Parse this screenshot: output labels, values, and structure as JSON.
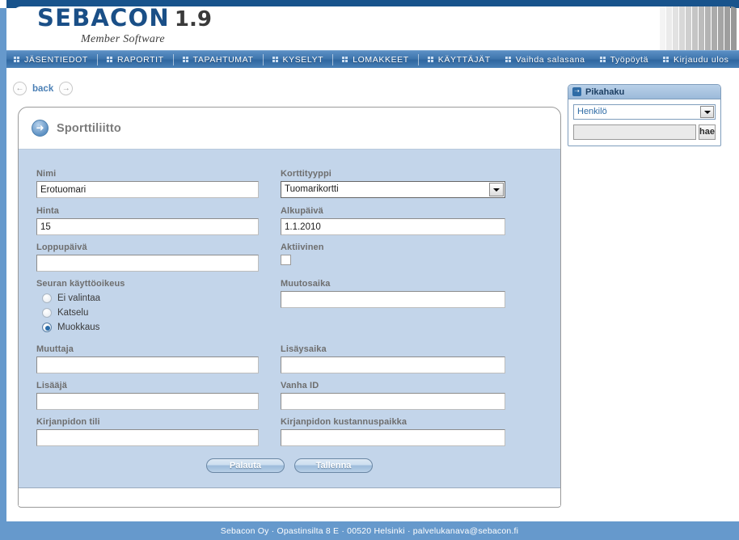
{
  "brand": {
    "name": "SEBACON",
    "version": "1.9",
    "tagline": "Member Software"
  },
  "nav": {
    "primary": [
      {
        "label": "JÄSENTIEDOT"
      },
      {
        "label": "RAPORTIT"
      },
      {
        "label": "TAPAHTUMAT"
      },
      {
        "label": "KYSELYT"
      },
      {
        "label": "LOMAKKEET"
      },
      {
        "label": "KÄYTTÄJÄT"
      }
    ],
    "secondary": [
      {
        "label": "Vaihda salasana"
      },
      {
        "label": "Työpöytä"
      },
      {
        "label": "Kirjaudu ulos"
      }
    ]
  },
  "backbar": {
    "label": "back",
    "prev_icon": "arrow-left-icon",
    "next_icon": "arrow-right-icon"
  },
  "card": {
    "icon": "arrow-right-circle-icon",
    "title": "Sporttiliitto"
  },
  "form": {
    "nimi": {
      "label": "Nimi",
      "value": "Erotuomari"
    },
    "korttityyppi": {
      "label": "Korttityyppi",
      "value": "Tuomarikortti"
    },
    "hinta": {
      "label": "Hinta",
      "value": "15"
    },
    "alkupaiva": {
      "label": "Alkupäivä",
      "value": "1.1.2010"
    },
    "loppupaiva": {
      "label": "Loppupäivä",
      "value": ""
    },
    "aktiivinen": {
      "label": "Aktiivinen",
      "checked": false
    },
    "seuran_kayttooikeus": {
      "label": "Seuran käyttöoikeus",
      "selected": "Muokkaus",
      "options": [
        {
          "label": "Ei valintaa",
          "selected": false
        },
        {
          "label": "Katselu",
          "selected": false
        },
        {
          "label": "Muokkaus",
          "selected": true
        }
      ]
    },
    "muutosaika": {
      "label": "Muutosaika",
      "value": ""
    },
    "muuttaja": {
      "label": "Muuttaja",
      "value": ""
    },
    "lisaysaika": {
      "label": "Lisäysaika",
      "value": ""
    },
    "lisaaja": {
      "label": "Lisääjä",
      "value": ""
    },
    "vanha_id": {
      "label": "Vanha ID",
      "value": ""
    },
    "kirjanpidon_tili": {
      "label": "Kirjanpidon tili",
      "value": ""
    },
    "kirjanpidon_kustannuspaikka": {
      "label": "Kirjanpidon kustannuspaikka",
      "value": ""
    }
  },
  "buttons": {
    "reset": "Palauta",
    "save": "Tallenna"
  },
  "quick_search": {
    "icon": "arrow-right-box-icon",
    "title": "Pikahaku",
    "type_value": "Henkilö",
    "input_value": "",
    "search_button": "hae"
  },
  "footer": {
    "text": "Sebacon Oy · Opastinsilta 8 E · 00520 Helsinki · palvelukanava@sebacon.fi"
  },
  "colors": {
    "brand_blue": "#1a4f87",
    "rail_blue": "#6699cc",
    "nav_blue": "#3f76ae",
    "form_bg": "#c3d5ea",
    "link_blue": "#4a7fb5"
  }
}
